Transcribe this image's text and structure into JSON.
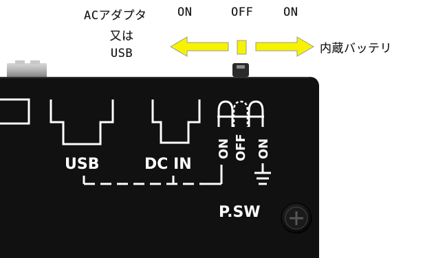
{
  "annotation": {
    "left_label_lines": [
      "ACアダプタ",
      "又は",
      "USB"
    ],
    "position_on_left": "ON",
    "position_off": "OFF",
    "position_on_right": "ON",
    "right_label": "内蔵バッテリ",
    "arrow_color": "#f7f200",
    "arrow_outline": "#9a9a9a"
  },
  "panel": {
    "usb_label": "USB",
    "dc_in_label": "DC IN",
    "switch_on_label": "ON",
    "switch_off_label": "OFF",
    "switch_on2_label": "ON",
    "power_switch_label": "P.SW",
    "panel_color": "#111111",
    "line_color": "#ffffff"
  }
}
